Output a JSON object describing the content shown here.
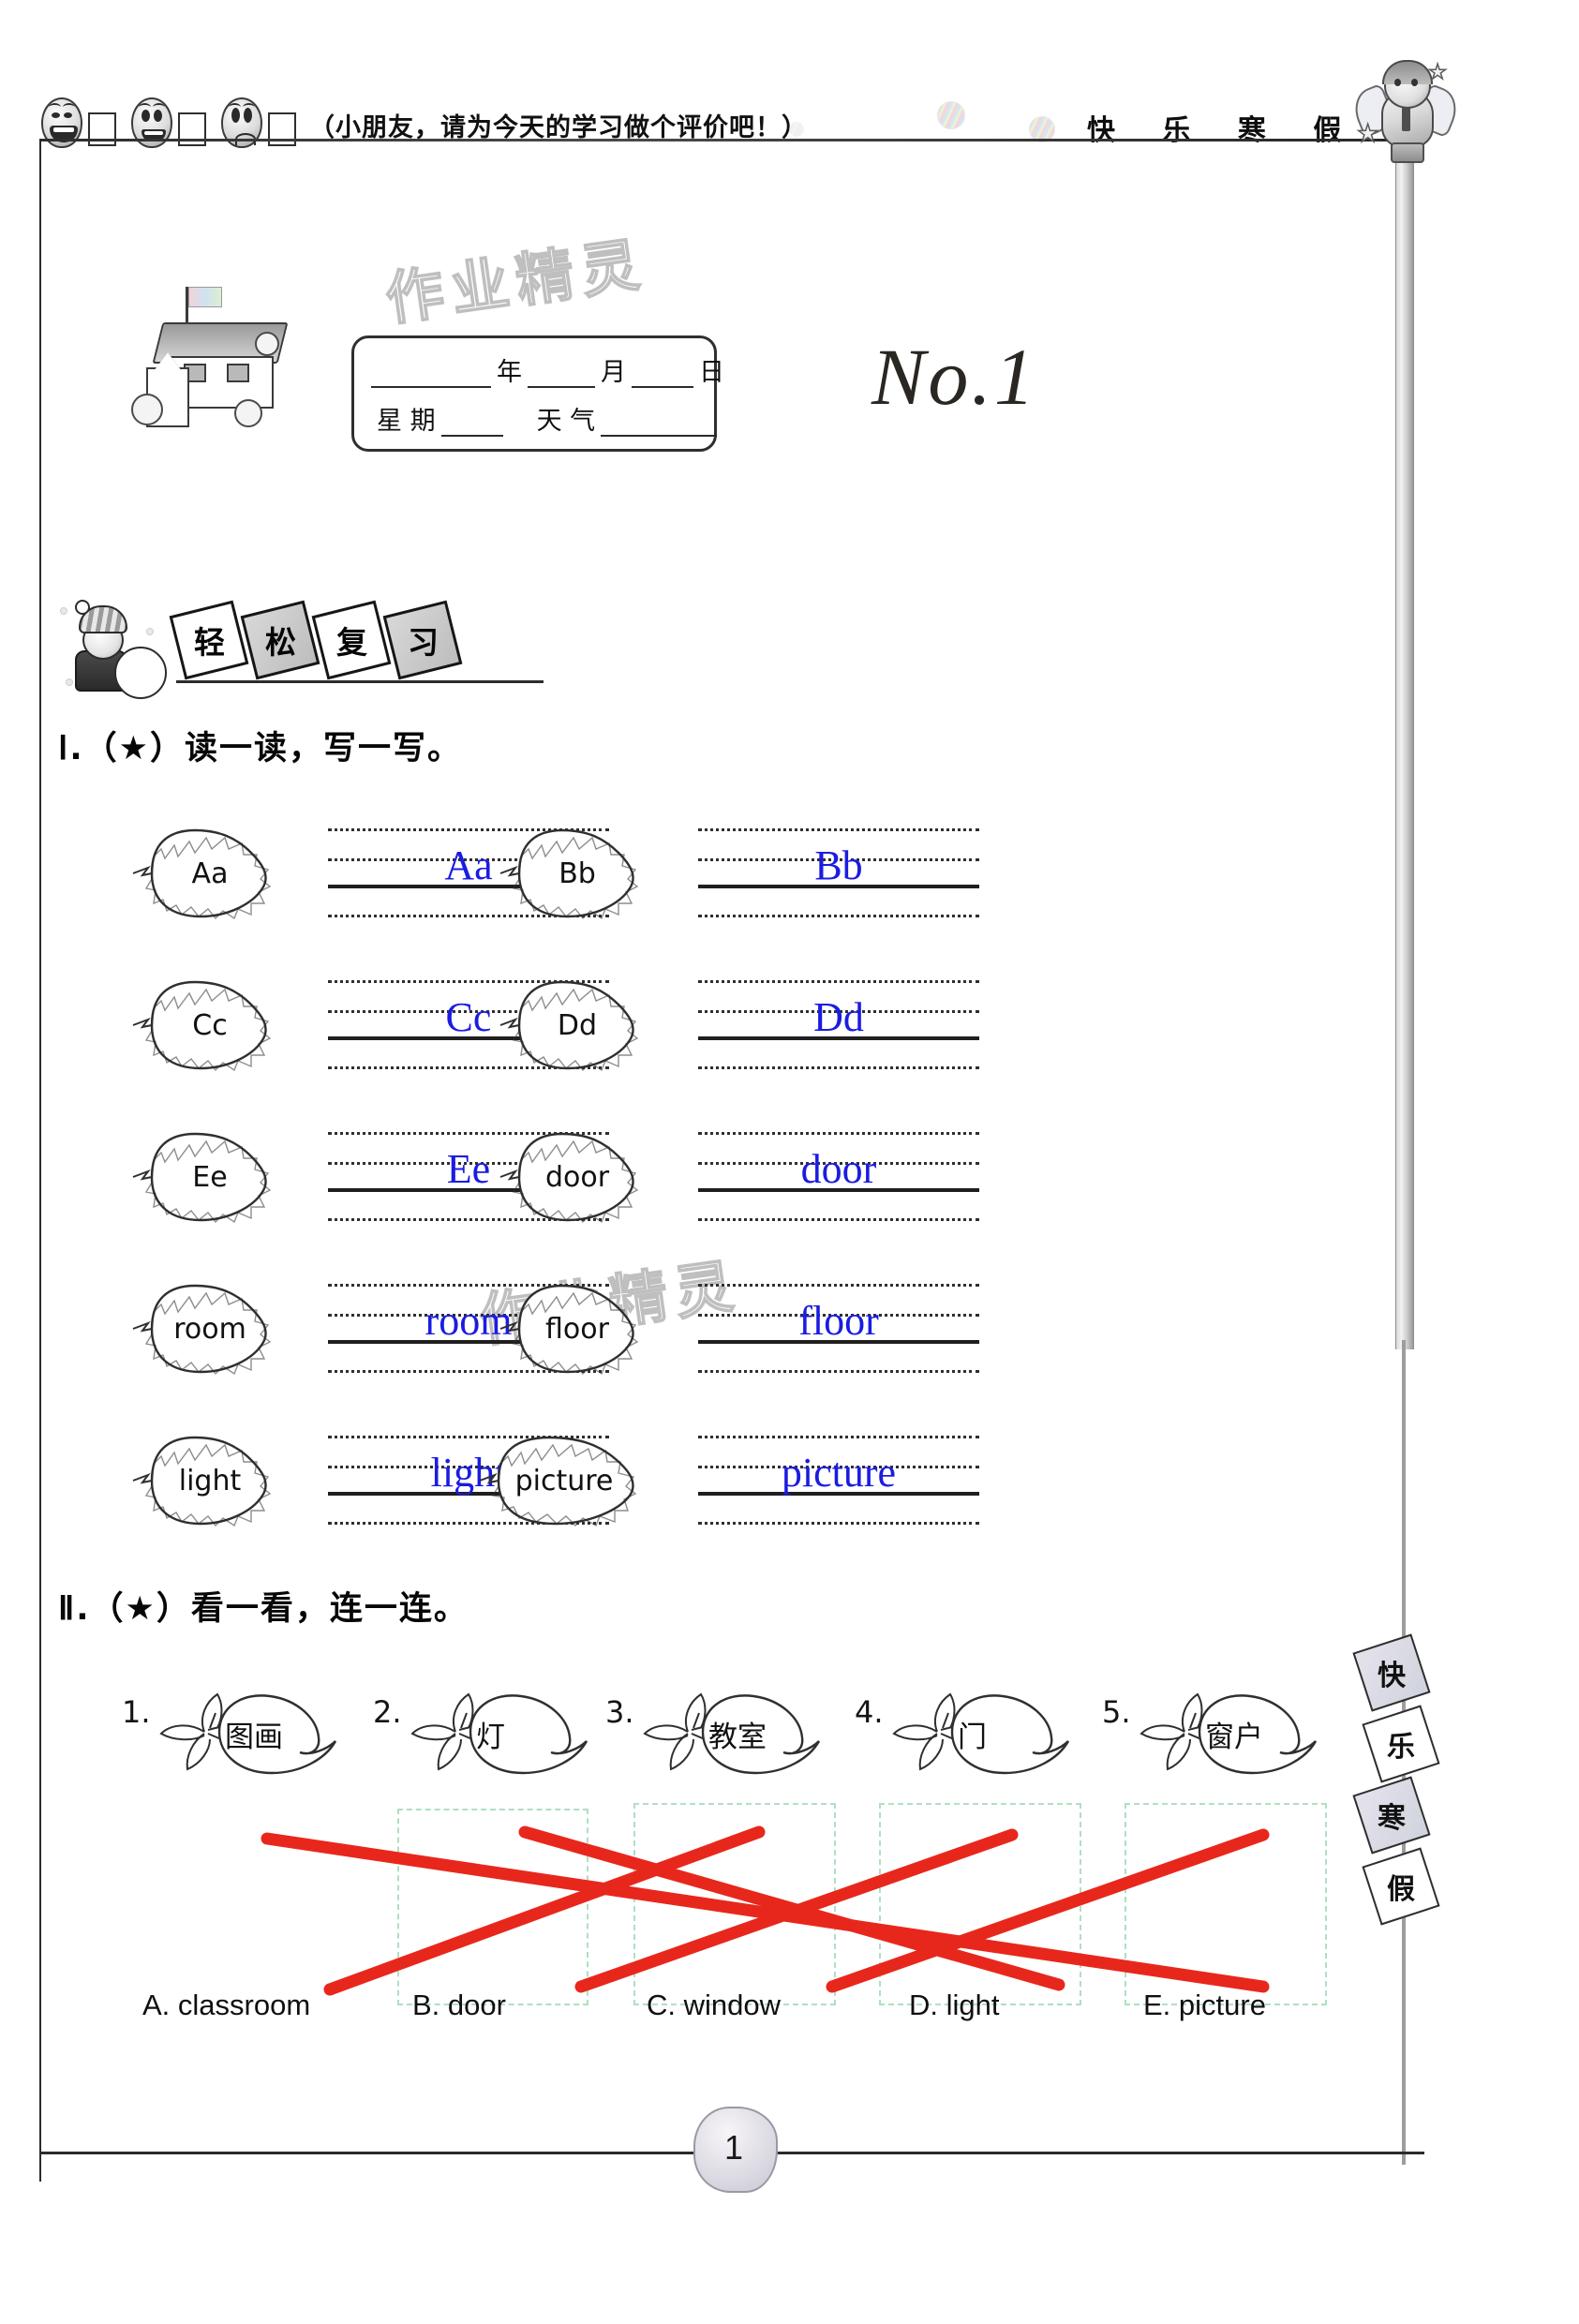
{
  "header": {
    "evaluation_prompt": "（小朋友，请为今天的学习做个评价吧！）",
    "book_title": "快 乐 寒 假",
    "smileys": [
      "laughing-face",
      "smiling-face",
      "sad-face"
    ]
  },
  "watermarks": {
    "text": "作业精灵"
  },
  "date_card": {
    "year_label": "年",
    "month_label": "月",
    "day_label": "日",
    "weekday_label": "星 期",
    "weather_label": "天 气"
  },
  "lesson": {
    "number_title": "No.1"
  },
  "section_banner": {
    "chars": [
      "轻",
      "松",
      "复",
      "习"
    ]
  },
  "side_strip": {
    "chars": [
      "快",
      "乐",
      "寒",
      "假"
    ]
  },
  "exercise_1": {
    "heading_numeral": "Ⅰ",
    "heading_text": ".（★）读一读，写一写。",
    "items": [
      {
        "prompt": "Aa",
        "answer": "Aa"
      },
      {
        "prompt": "Bb",
        "answer": "Bb"
      },
      {
        "prompt": "Cc",
        "answer": "Cc"
      },
      {
        "prompt": "Dd",
        "answer": "Dd"
      },
      {
        "prompt": "Ee",
        "answer": "Ee"
      },
      {
        "prompt": "door",
        "answer": "door"
      },
      {
        "prompt": "room",
        "answer": "room"
      },
      {
        "prompt": "floor",
        "answer": "floor"
      },
      {
        "prompt": "light",
        "answer": "light"
      },
      {
        "prompt": "picture",
        "answer": "picture"
      }
    ]
  },
  "exercise_2": {
    "heading_numeral": "Ⅱ",
    "heading_text": ".（★）看一看，连一连。",
    "items": [
      {
        "number": "1.",
        "word": "图画"
      },
      {
        "number": "2.",
        "word": "灯"
      },
      {
        "number": "3.",
        "word": "教室"
      },
      {
        "number": "4.",
        "word": "门"
      },
      {
        "number": "5.",
        "word": "窗户"
      }
    ],
    "options": [
      {
        "letter": "A.",
        "label": "A. classroom"
      },
      {
        "letter": "B.",
        "label": "B. door"
      },
      {
        "letter": "C.",
        "label": "C. window"
      },
      {
        "letter": "D.",
        "label": "D. light"
      },
      {
        "letter": "E.",
        "label": "E. picture"
      }
    ],
    "answer_lines": [
      {
        "from": "1",
        "to": "E",
        "note": "图画 → picture"
      },
      {
        "from": "2",
        "to": "D",
        "note": "灯 → light"
      },
      {
        "from": "3",
        "to": "A",
        "note": "教室 → classroom"
      },
      {
        "from": "4",
        "to": "B",
        "note": "门 → door"
      },
      {
        "from": "5",
        "to": "C",
        "note": "窗户 → window"
      }
    ],
    "line_color": "#e8271c"
  },
  "footer": {
    "page_number": "1"
  },
  "colors": {
    "answer_ink": "#1b1ce0",
    "match_line": "#e8271c",
    "rule": "#2b2b2b",
    "option_box": "#aee0c2"
  }
}
